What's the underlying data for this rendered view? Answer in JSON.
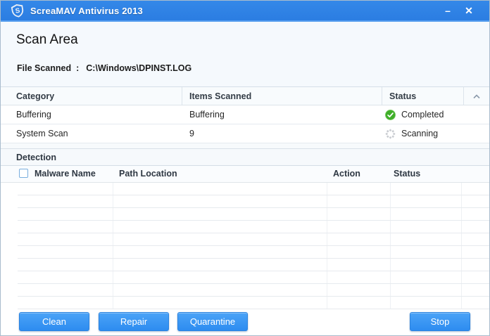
{
  "window": {
    "title": "ScreaMAV Antivirus 2013",
    "controls": {
      "minimize_glyph": "–",
      "close_glyph": "✕"
    }
  },
  "header": {
    "title": "Scan Area",
    "file_scanned_label": "File Scanned",
    "file_scanned_separator": ":",
    "file_scanned_value": "C:\\Windows\\DPINST.LOG"
  },
  "scan_table": {
    "columns": {
      "category": "Category",
      "items": "Items Scanned",
      "status": "Status"
    },
    "collapse_icon": "chevron-up",
    "rows": [
      {
        "category": "Buffering",
        "items": "Buffering",
        "status": "Completed",
        "status_icon": "check-circle-icon",
        "status_color": "#3fae29"
      },
      {
        "category": "System Scan",
        "items": "9",
        "status": "Scanning",
        "status_icon": "spinner-icon",
        "status_color": "#c9ccd1"
      }
    ]
  },
  "detection": {
    "title": "Detection",
    "columns": {
      "malware": "Malware Name",
      "path": "Path Location",
      "action": "Action",
      "status": "Status"
    },
    "select_all_checked": false,
    "rows": []
  },
  "buttons": {
    "clean": "Clean",
    "repair": "Repair",
    "quarantine": "Quarantine",
    "stop": "Stop"
  },
  "colors": {
    "titlebar_blue": "#2e81e5",
    "panel_light_blue": "#f5f9fd",
    "button_blue": "#2d8cf0",
    "success_green": "#3fae29",
    "spinner_gray": "#c9ccd1"
  }
}
